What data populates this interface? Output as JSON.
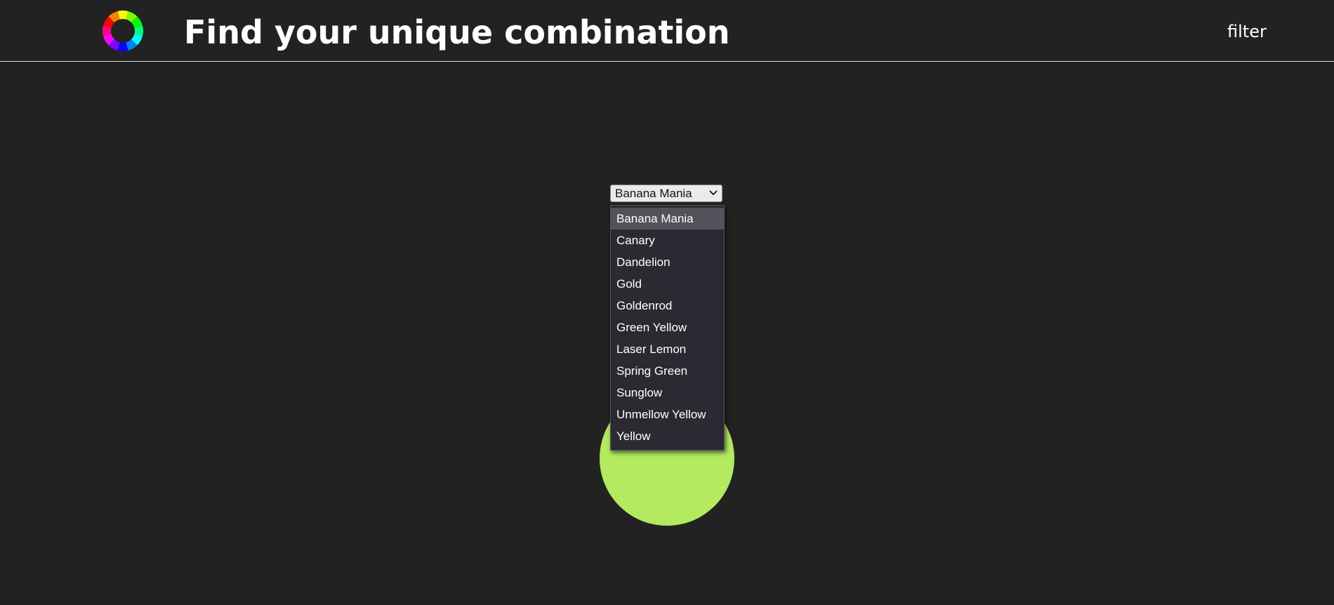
{
  "header": {
    "title": "Find your unique combination",
    "filter_label": "filter"
  },
  "color_select": {
    "selected": "Banana Mania",
    "options": [
      "Banana Mania",
      "Canary",
      "Dandelion",
      "Gold",
      "Goldenrod",
      "Green Yellow",
      "Laser Lemon",
      "Spring Green",
      "Sunglow",
      "Unmellow Yellow",
      "Yellow"
    ],
    "highlighted_index": 0
  },
  "preview": {
    "color": "#b3ea5f"
  },
  "colors": {
    "background": "#222222",
    "header_rule": "#d9d9d9"
  },
  "icons": {
    "logo": "color-wheel-icon",
    "select_arrow": "chevron-down-icon"
  }
}
